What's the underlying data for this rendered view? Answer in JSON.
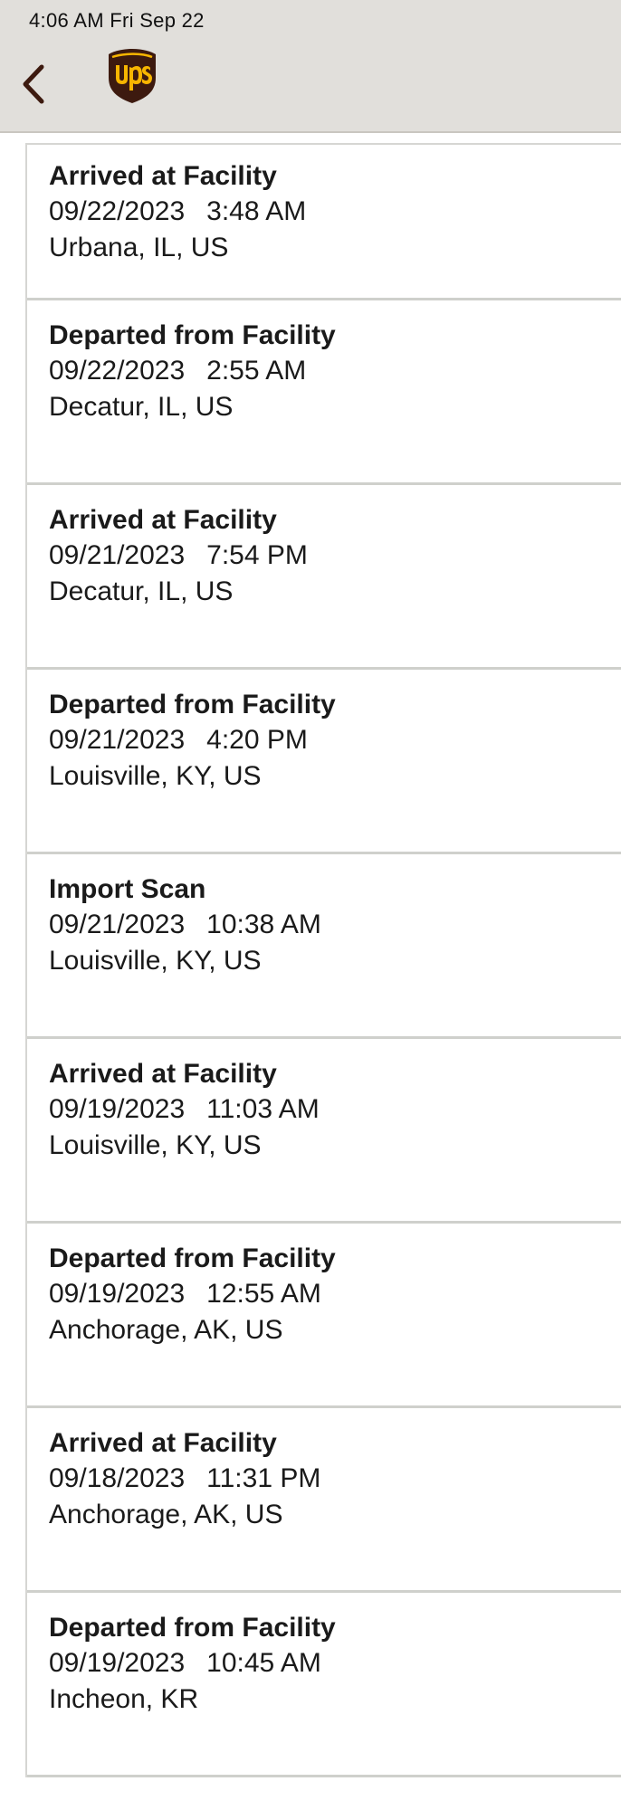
{
  "status_bar": {
    "time": "4:06 AM   Fri Sep 22"
  },
  "header": {
    "back_icon": "chevron-left-icon",
    "logo": "ups",
    "brand_color": "#3d1a0f",
    "gold": "#f7b500"
  },
  "events": [
    {
      "status": "Arrived at Facility",
      "date": "09/22/2023",
      "time": "3:48 AM",
      "location": "Urbana, IL, US"
    },
    {
      "status": "Departed from Facility",
      "date": "09/22/2023",
      "time": "2:55 AM",
      "location": "Decatur, IL, US"
    },
    {
      "status": "Arrived at Facility",
      "date": "09/21/2023",
      "time": "7:54 PM",
      "location": "Decatur, IL, US"
    },
    {
      "status": "Departed from Facility",
      "date": "09/21/2023",
      "time": "4:20 PM",
      "location": "Louisville, KY, US"
    },
    {
      "status": "Import Scan",
      "date": "09/21/2023",
      "time": "10:38 AM",
      "location": "Louisville, KY, US"
    },
    {
      "status": "Arrived at Facility",
      "date": "09/19/2023",
      "time": "11:03 AM",
      "location": "Louisville, KY, US"
    },
    {
      "status": "Departed from Facility",
      "date": "09/19/2023",
      "time": "12:55 AM",
      "location": "Anchorage, AK, US"
    },
    {
      "status": "Arrived at Facility",
      "date": "09/18/2023",
      "time": "11:31 PM",
      "location": "Anchorage, AK, US"
    },
    {
      "status": "Departed from Facility",
      "date": "09/19/2023",
      "time": "10:45 AM",
      "location": "Incheon, KR"
    }
  ]
}
